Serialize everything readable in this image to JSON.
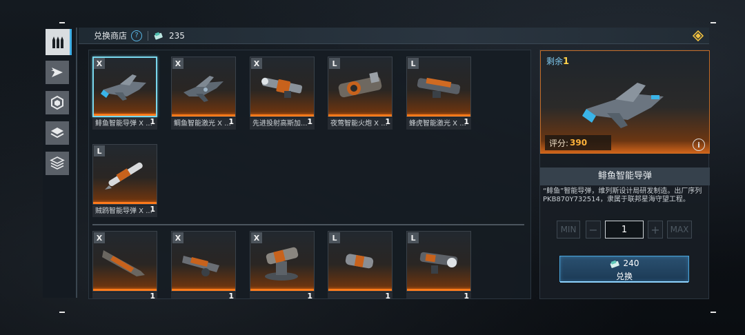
{
  "header": {
    "title": "兑换商店",
    "help_glyph": "?",
    "currency_amount": "235"
  },
  "sidenav": {
    "items": [
      {
        "icon": "bullets-icon",
        "active": true
      },
      {
        "icon": "fighter-icon",
        "active": false
      },
      {
        "icon": "hexagon-icon",
        "active": false
      },
      {
        "icon": "layers-icon",
        "active": false
      },
      {
        "icon": "stacked-layers-icon",
        "active": false
      }
    ]
  },
  "items_top": [
    {
      "grade": "X",
      "count": "1",
      "name": "鲱鱼智能导弹 X ...",
      "selected": true,
      "icon": "missile-drone-icon"
    },
    {
      "grade": "X",
      "count": "1",
      "name": "鲷鱼智能激光 X ...",
      "selected": false,
      "icon": "laser-drone-icon"
    },
    {
      "grade": "X",
      "count": "1",
      "name": "先进投射高斯加...",
      "selected": false,
      "icon": "gauss-cannon-icon"
    },
    {
      "grade": "L",
      "count": "1",
      "name": "夜莺智能火炮 X ...",
      "selected": false,
      "icon": "artillery-icon"
    },
    {
      "grade": "L",
      "count": "1",
      "name": "蜂虎智能激光 X ...",
      "selected": false,
      "icon": "laser-turret-icon"
    },
    {
      "grade": "L",
      "count": "1",
      "name": "贼鸥智能导弹 X ...",
      "selected": false,
      "icon": "missile-icon"
    }
  ],
  "items_bottom": [
    {
      "grade": "X",
      "count": "1",
      "name": "",
      "icon": "railgun-icon"
    },
    {
      "grade": "X",
      "count": "1",
      "name": "",
      "icon": "turret-icon"
    },
    {
      "grade": "X",
      "count": "1",
      "name": "",
      "icon": "cannon-mount-icon"
    },
    {
      "grade": "L",
      "count": "1",
      "name": "",
      "icon": "barrel-icon"
    },
    {
      "grade": "L",
      "count": "1",
      "name": "",
      "icon": "heavy-gun-icon"
    }
  ],
  "detail": {
    "remain_label": "剩余",
    "remain_value": "1",
    "score_label": "评分:",
    "score_value": "390",
    "info_glyph": "i",
    "title": "鲱鱼智能导弹",
    "description": "“鲱鱼”智能导弹，维列斯设计局研发制造。出厂序列PKB870Y732514，隶属于联邦星海守望工程。",
    "qty_min": "MIN",
    "qty_minus": "−",
    "qty_value": "1",
    "qty_plus": "+",
    "qty_max": "MAX",
    "price": "240",
    "exchange_label": "兑换"
  },
  "colors": {
    "accent_orange": "#ff7a1a",
    "accent_blue": "#4aa8e0",
    "score_gold": "#ffb23a"
  }
}
